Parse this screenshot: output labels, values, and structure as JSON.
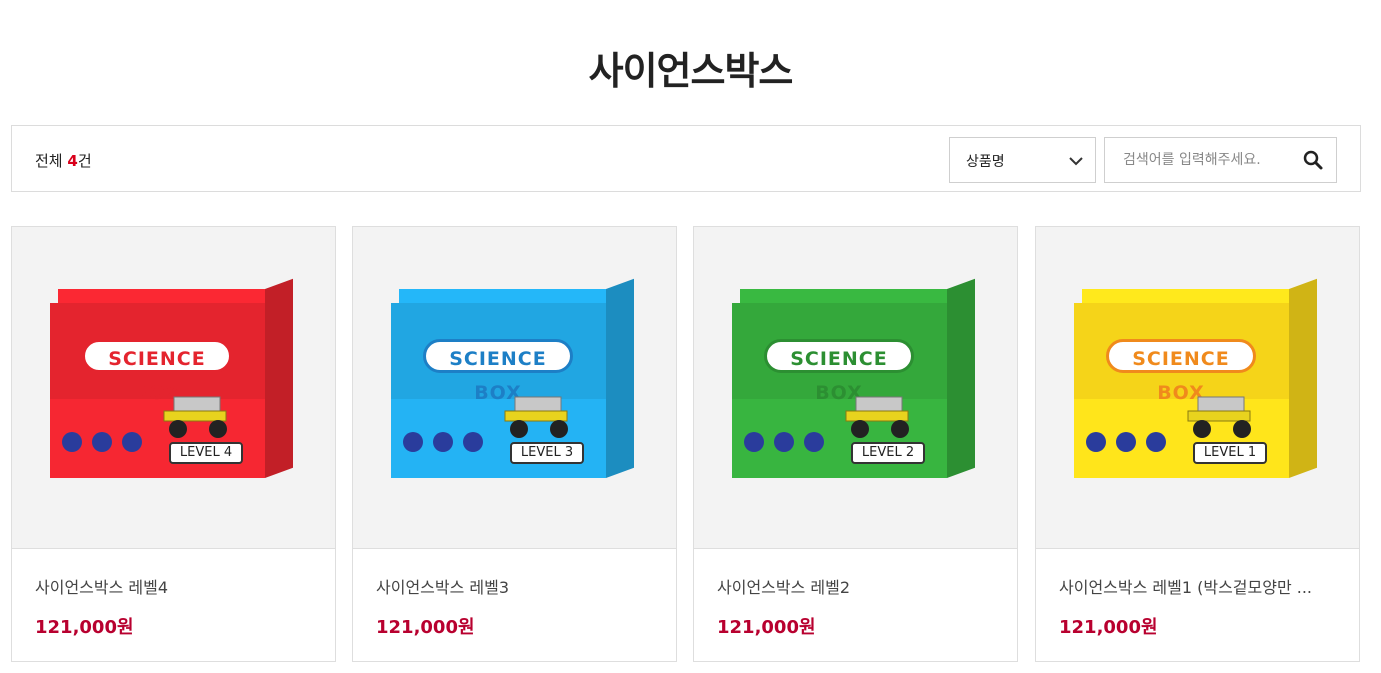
{
  "page_title": "사이언스박스",
  "toolbar": {
    "count_prefix": "전체 ",
    "count_num": "4",
    "count_suffix": "건",
    "sort_selected": "상품명",
    "search_placeholder": "검색어를 입력해주세요."
  },
  "products": [
    {
      "name": "사이언스박스 레벨4",
      "price": "121,000원",
      "box_color": "#e4242e",
      "logo_color": "#e4242e",
      "level_label": "LEVEL 4"
    },
    {
      "name": "사이언스박스 레벨3",
      "price": "121,000원",
      "box_color": "#21a6e2",
      "logo_color": "#1d7fc6",
      "level_label": "LEVEL 3"
    },
    {
      "name": "사이언스박스 레벨2",
      "price": "121,000원",
      "box_color": "#34a83b",
      "logo_color": "#2c8f32",
      "level_label": "LEVEL 2"
    },
    {
      "name": "사이언스박스 레벨1 (박스겉모양만 ...",
      "price": "121,000원",
      "box_color": "#f5d419",
      "logo_color": "#f08a1c",
      "level_label": "LEVEL 1"
    }
  ],
  "box_logo_text": "SCIENCE BOX",
  "colors": {
    "accent": "#d9001b",
    "price": "#b8002f"
  }
}
